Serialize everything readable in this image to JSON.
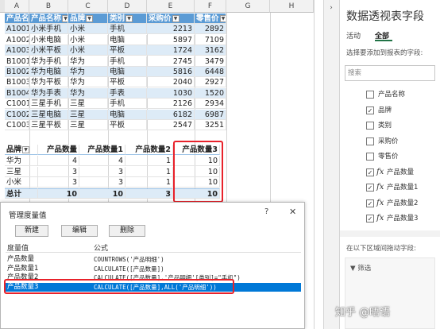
{
  "columns": [
    "A",
    "B",
    "C",
    "D",
    "E",
    "F",
    "G",
    "H"
  ],
  "table": {
    "headers": [
      "产品名",
      "产品名称",
      "品牌",
      "类别",
      "采购价",
      "零售价"
    ],
    "rows": [
      [
        "A1001",
        "小米手机",
        "小米",
        "手机",
        "2213",
        "2892"
      ],
      [
        "A1002",
        "小米电脑",
        "小米",
        "电脑",
        "5897",
        "7109"
      ],
      [
        "A1003",
        "小米平板",
        "小米",
        "平板",
        "1724",
        "3162"
      ],
      [
        "B1001",
        "华为手机",
        "华为",
        "手机",
        "2745",
        "3479"
      ],
      [
        "B1002",
        "华为电脑",
        "华为",
        "电脑",
        "5816",
        "6448"
      ],
      [
        "B1003",
        "华为平板",
        "华为",
        "平板",
        "2040",
        "2927"
      ],
      [
        "B1004",
        "华为手表",
        "华为",
        "手表",
        "1030",
        "1520"
      ],
      [
        "C1001",
        "三星手机",
        "三星",
        "手机",
        "2126",
        "2934"
      ],
      [
        "C1002",
        "三星电脑",
        "三星",
        "电脑",
        "6182",
        "6987"
      ],
      [
        "C1003",
        "三星平板",
        "三星",
        "平板",
        "2547",
        "3251"
      ]
    ]
  },
  "pivot": {
    "headers": [
      "品牌",
      "产品数量",
      "产品数量1",
      "产品数量2",
      "产品数量3"
    ],
    "rows": [
      [
        "华为",
        "4",
        "4",
        "1",
        "10"
      ],
      [
        "三星",
        "3",
        "3",
        "1",
        "10"
      ],
      [
        "小米",
        "3",
        "3",
        "1",
        "10"
      ]
    ],
    "total": [
      "总计",
      "10",
      "10",
      "3",
      "10"
    ]
  },
  "panel": {
    "title": "数据透视表字段",
    "tab_active": "活动",
    "tab_all": "全部",
    "choose_label": "选择要添加到报表的字段:",
    "search_placeholder": "搜索",
    "fields": [
      {
        "name": "产品名称",
        "checked": false,
        "measure": false
      },
      {
        "name": "品牌",
        "checked": true,
        "measure": false
      },
      {
        "name": "类别",
        "checked": false,
        "measure": false
      },
      {
        "name": "采购价",
        "checked": false,
        "measure": false
      },
      {
        "name": "零售价",
        "checked": false,
        "measure": false
      },
      {
        "name": "产品数量",
        "checked": true,
        "measure": true
      },
      {
        "name": "产品数量1",
        "checked": true,
        "measure": true
      },
      {
        "name": "产品数量2",
        "checked": true,
        "measure": true
      },
      {
        "name": "产品数量3",
        "checked": true,
        "measure": true
      }
    ],
    "drag_label": "在以下区域间拖动字段:",
    "filter_label": "筛选",
    "fx_symbol": "fx",
    "check_mark": "✓"
  },
  "watermark": "知乎 @晤语",
  "dialog": {
    "title": "管理度量值",
    "help": "?",
    "close": "✕",
    "buttons": [
      "新建",
      "编辑",
      "删除"
    ],
    "col_measure": "度量值",
    "col_formula": "公式",
    "rows": [
      {
        "name": "产品数量",
        "formula": "COUNTROWS('产品明细')",
        "selected": false
      },
      {
        "name": "产品数量1",
        "formula": "CALCULATE([产品数量])",
        "selected": false
      },
      {
        "name": "产品数量2",
        "formula": "CALCULATE([产品数量],'产品明细'[类别]=\"手机\")",
        "selected": false
      },
      {
        "name": "产品数量3",
        "formula": "CALCULATE([产品数量],ALL('产品明细'))",
        "selected": true
      }
    ]
  },
  "colors": {
    "table_header": "#5b9bd5",
    "band": "#ddebf7",
    "highlight": "#e8222b",
    "selection": "#0078d7",
    "accent": "#217346"
  }
}
